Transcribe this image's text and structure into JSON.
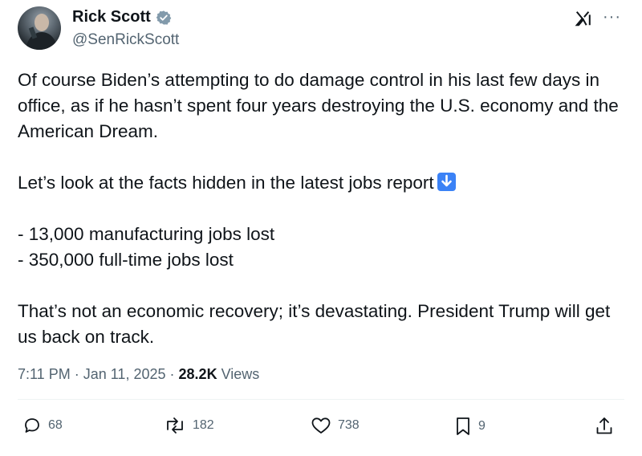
{
  "author": {
    "name": "Rick Scott",
    "handle": "@SenRickScott",
    "verified": true,
    "avatar_icon": "avatar-image"
  },
  "header": {
    "x_logo_icon": "x-logo-icon",
    "more_icon": "more-icon"
  },
  "tweet": {
    "paragraphs": [
      "Of course Biden’s attempting to do damage control in his last few days in office, as if he hasn’t spent four years destroying the U.S. economy and the American Dream.",
      "Let’s look at the facts hidden in the latest jobs report",
      "- 13,000 manufacturing jobs lost\n- 350,000 full-time jobs lost",
      "That’s not an economic recovery; it’s devastating. President Trump will get us back on track."
    ],
    "emoji": "down-arrow-emoji"
  },
  "meta": {
    "time": "7:11 PM",
    "separator": "·",
    "date": "Jan 11, 2025",
    "views_count": "28.2K",
    "views_label": "Views"
  },
  "actions": {
    "reply_count": "68",
    "retweet_count": "182",
    "like_count": "738",
    "bookmark_count": "9"
  },
  "colors": {
    "text": "#0f1419",
    "secondary": "#536471",
    "verified_blue": "#829aab",
    "emoji_blue": "#3b82f6"
  }
}
